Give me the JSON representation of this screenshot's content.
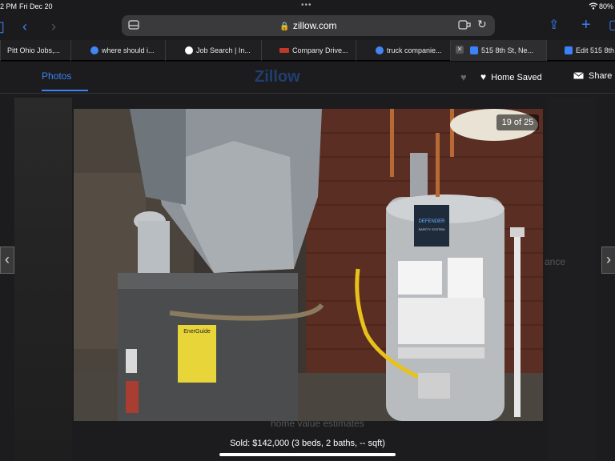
{
  "status_bar": {
    "time": "2 PM",
    "date": "Fri Dec 20",
    "battery": "80%"
  },
  "browser": {
    "url": "zillow.com",
    "tabs": [
      {
        "label": "Pitt Ohio Jobs,...",
        "favicon_color": "#2f6fb3"
      },
      {
        "label": "where should i...",
        "favicon_color": "#4285f4"
      },
      {
        "label": "Job Search | In...",
        "favicon_color": "#ffffff"
      },
      {
        "label": "Company Drive...",
        "favicon_color": "#c0392b"
      },
      {
        "label": "truck companie...",
        "favicon_color": "#4285f4"
      },
      {
        "label": "515 8th St, Ne...",
        "favicon_color": "#3a82f7",
        "active": true
      },
      {
        "label": "Edit 515 8th",
        "favicon_color": "#3a82f7"
      }
    ]
  },
  "page": {
    "photos_tab": "Photos",
    "logo": "Zillow",
    "home_saved": "Home Saved",
    "share": "Share",
    "behind_text": "home value estimates",
    "behind_right": "ance"
  },
  "gallery": {
    "counter": "19 of 25",
    "caption": "Sold: $142,000 (3 beds, 2 baths, -- sqft)",
    "heater_label": "DEFENDER",
    "heater_sublabel": "SAFETY SYSTEM",
    "furnace_label": "EnerGuide"
  },
  "colors": {
    "accent": "#3a82f7",
    "background": "#1c1c1e"
  },
  "icons": [
    "sidebar-icon",
    "back-icon",
    "forward-icon",
    "lock-icon",
    "reload-icon",
    "share-icon",
    "add-tab-icon",
    "tabs-icon",
    "heart-icon",
    "mail-icon"
  ]
}
